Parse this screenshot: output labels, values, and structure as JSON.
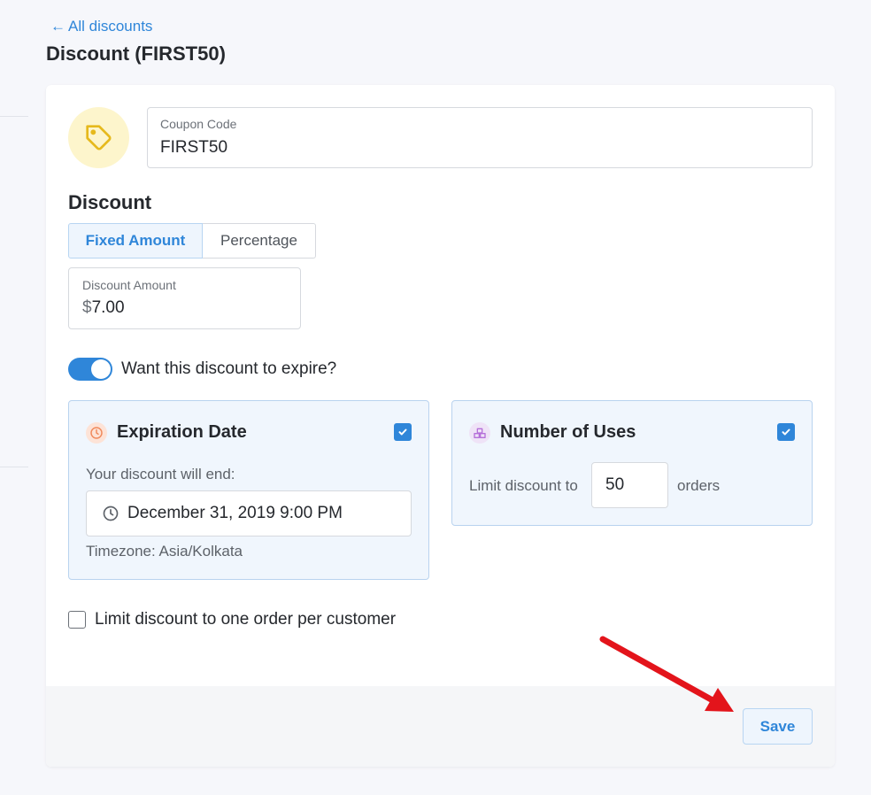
{
  "nav": {
    "back_arrow": "←",
    "back_label": "All discounts"
  },
  "page": {
    "title": "Discount (FIRST50)"
  },
  "coupon": {
    "label": "Coupon Code",
    "value": "FIRST50",
    "icon": "tag-icon"
  },
  "discount": {
    "section_title": "Discount",
    "type_options": [
      {
        "label": "Fixed Amount",
        "selected": true
      },
      {
        "label": "Percentage",
        "selected": false
      }
    ],
    "amount_label": "Discount Amount",
    "currency_symbol": "$",
    "amount_value": "7.00"
  },
  "expire_toggle": {
    "label": "Want this discount to expire?",
    "on": true
  },
  "expiration": {
    "title": "Expiration Date",
    "checked": true,
    "subtitle": "Your discount will end:",
    "date_value": "December 31, 2019 9:00 PM",
    "timezone": "Timezone: Asia/Kolkata",
    "icon": "clock-icon"
  },
  "uses": {
    "title": "Number of Uses",
    "checked": true,
    "prefix": "Limit discount to",
    "value": "50",
    "suffix": "orders",
    "icon": "boxes-icon"
  },
  "one_per_customer": {
    "label": "Limit discount to one order per customer",
    "checked": false
  },
  "footer": {
    "save_label": "Save"
  },
  "colors": {
    "accent": "#2f86d9",
    "panel_bg": "#f0f6fd",
    "tag_bg": "#fdf5cc",
    "tag_icon": "#e6b91c",
    "clock_bg": "#fde3d7",
    "clock_icon": "#f08a5d",
    "boxes_bg": "#efe3f7",
    "boxes_icon": "#b56fd9",
    "annotation_arrow": "#e3141b"
  }
}
